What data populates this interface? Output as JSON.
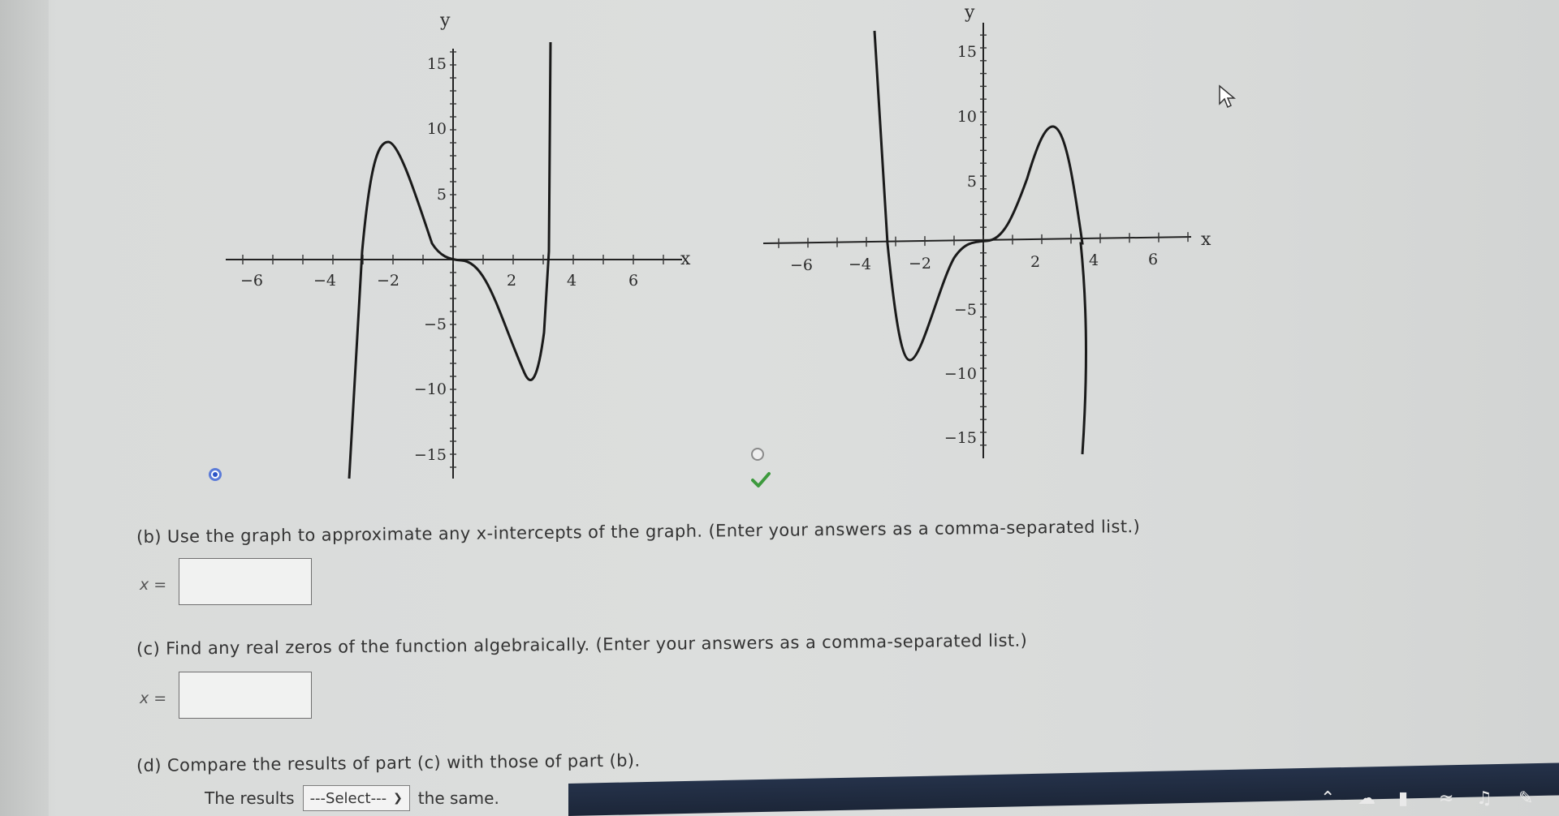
{
  "graph_left": {
    "x_axis_label": "x",
    "y_axis_label": "y",
    "x_ticks": [
      "−6",
      "−4",
      "−2",
      "2",
      "4",
      "6"
    ],
    "y_ticks": [
      "15",
      "10",
      "5",
      "−5",
      "−10",
      "−15"
    ]
  },
  "graph_right": {
    "x_axis_label": "x",
    "y_axis_label": "y",
    "x_ticks": [
      "−6",
      "−4",
      "−2",
      "2",
      "4",
      "6"
    ],
    "y_ticks": [
      "15",
      "10",
      "5",
      "−5",
      "−10",
      "−15"
    ]
  },
  "options": {
    "graph_1_selected": true,
    "graph_2_correct": true
  },
  "part_b": {
    "question": "(b) Use the graph to approximate any x-intercepts of the graph. (Enter your answers as a comma-separated list.)",
    "label": "x =",
    "value": ""
  },
  "part_c": {
    "question": "(c) Find any real zeros of the function algebraically. (Enter your answers as a comma-separated list.)",
    "label": "x =",
    "value": ""
  },
  "part_d": {
    "question": "(d) Compare the results of part (c) with those of part (b).",
    "prefix": "The results",
    "select_value": "---Select---",
    "suffix": "the same."
  },
  "colors": {
    "radio_selected": "#2c54c8",
    "check": "#3d9a3d",
    "taskbar": "#1f2a3d"
  }
}
